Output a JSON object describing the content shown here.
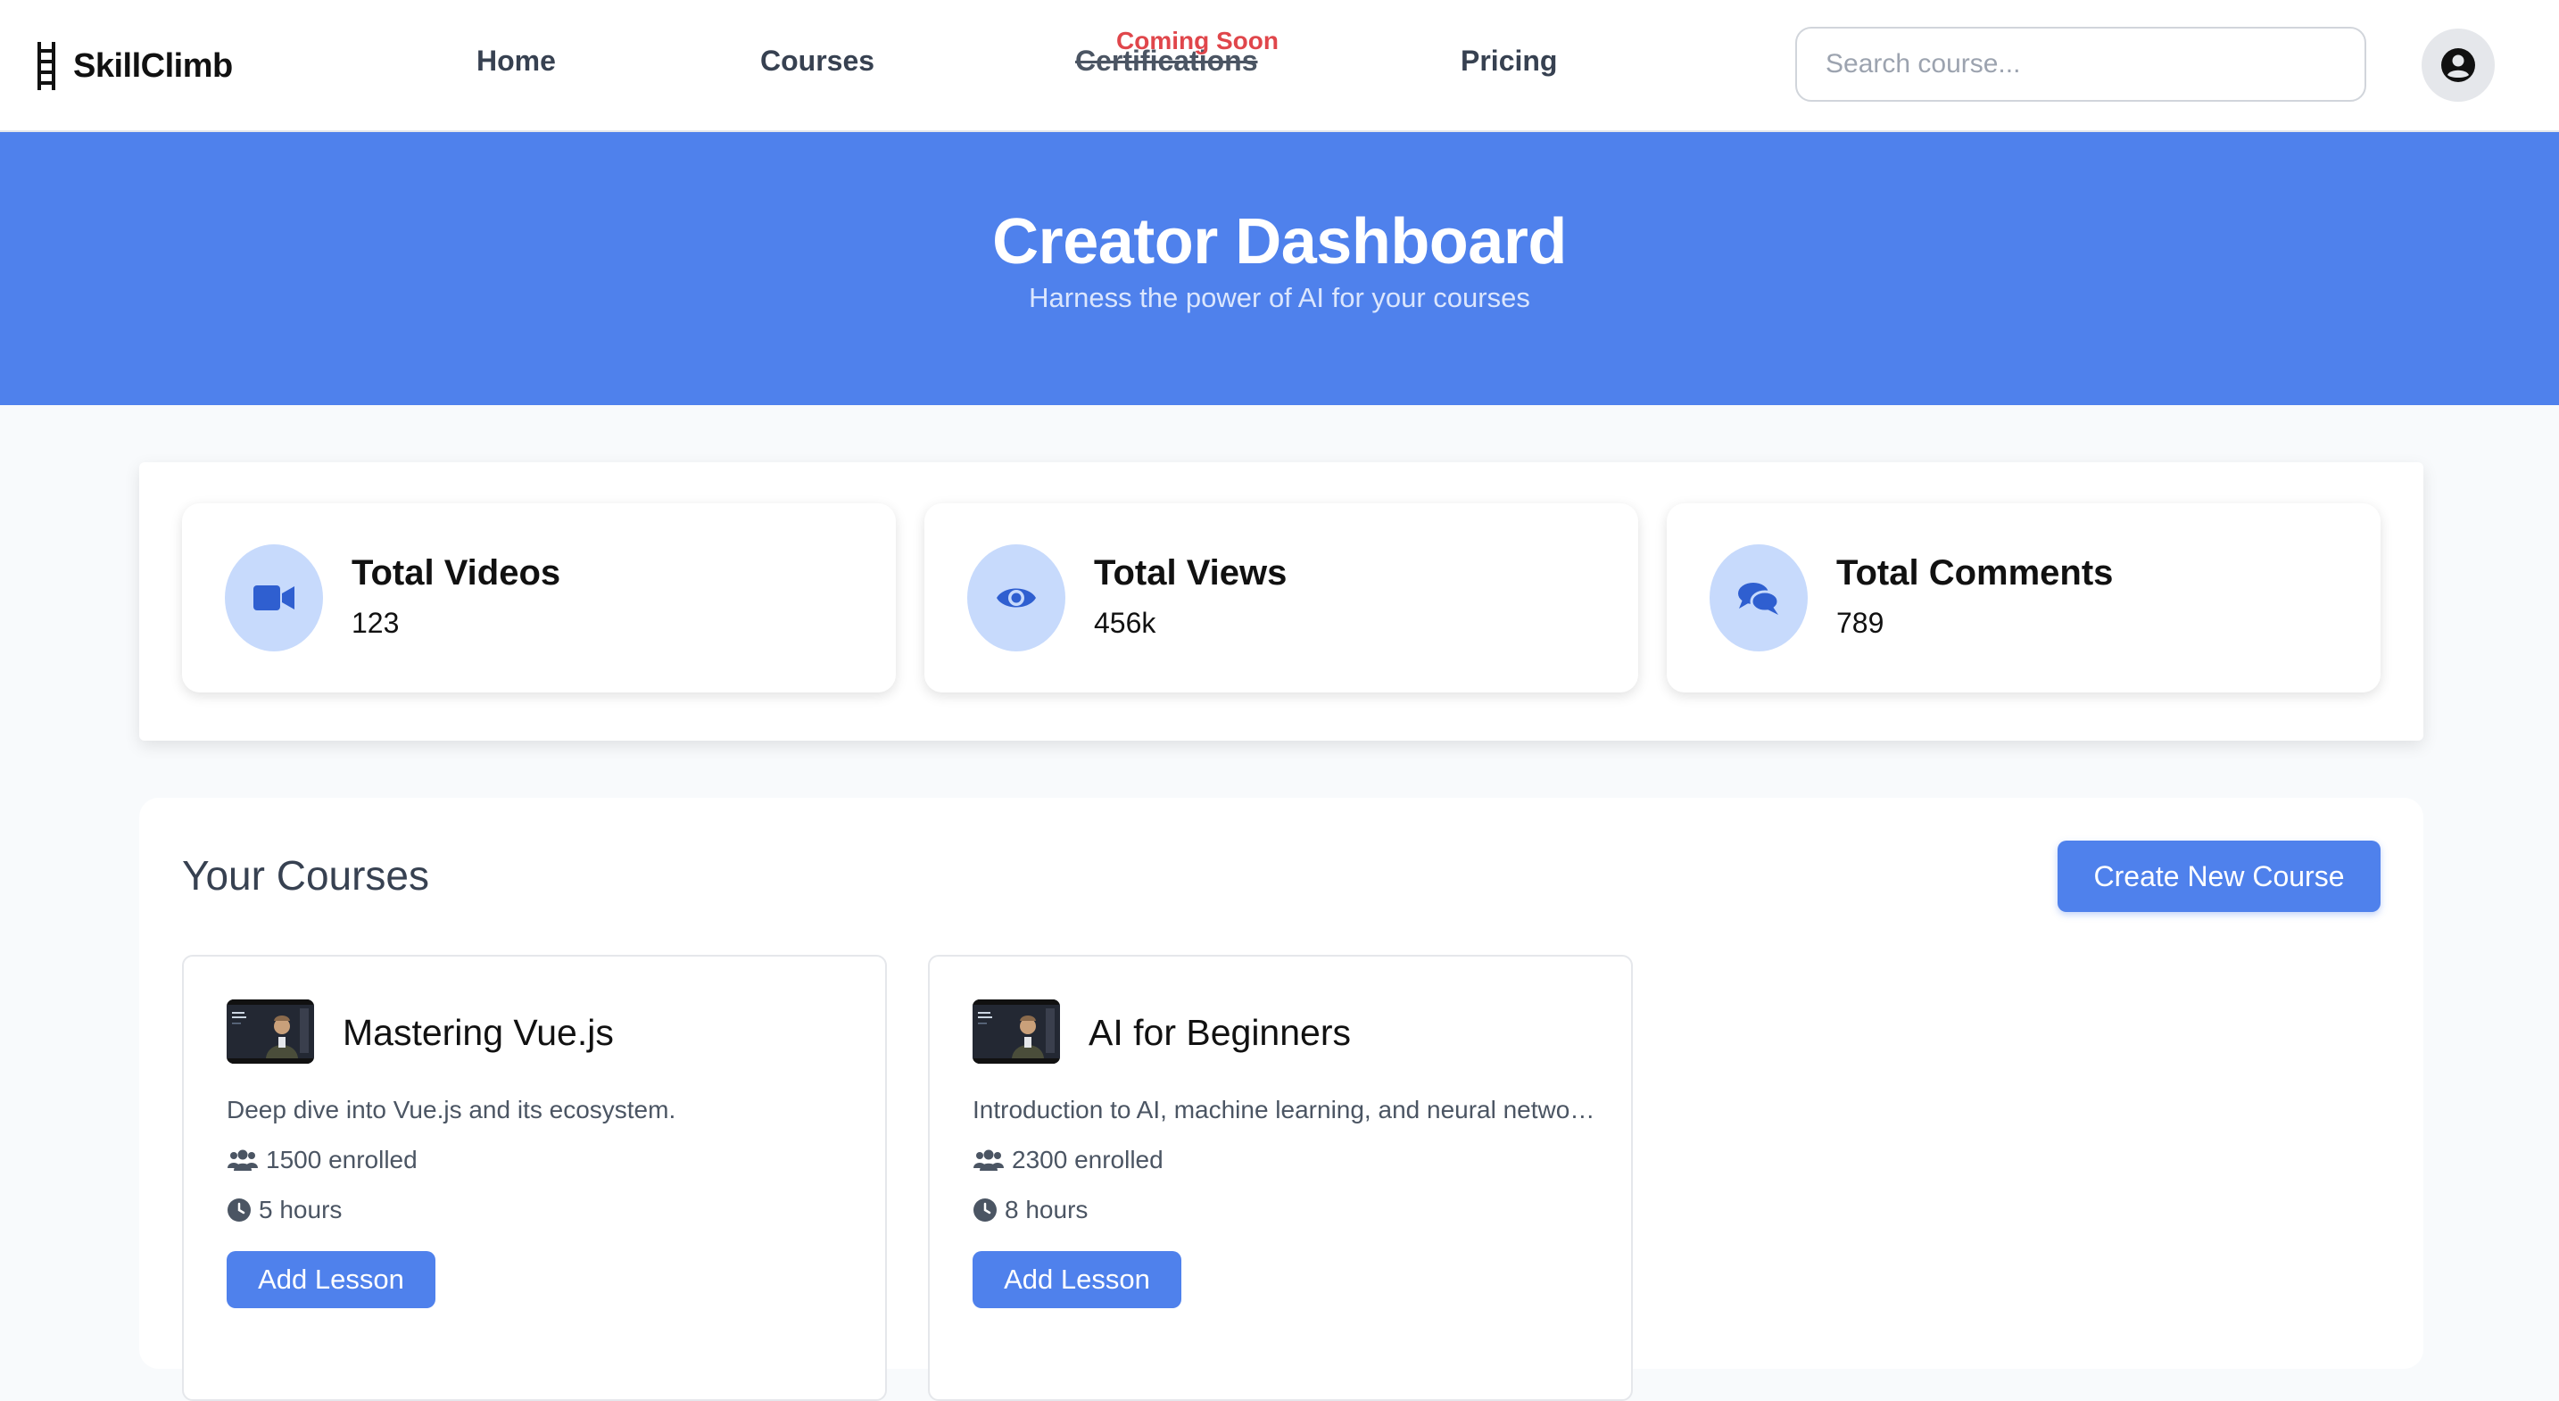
{
  "app": {
    "name": "SkillClimb",
    "logo_icon": "ladder-icon"
  },
  "nav": {
    "home": "Home",
    "courses": "Courses",
    "certifications": "Certifications",
    "coming_soon": "Coming Soon",
    "pricing": "Pricing"
  },
  "search": {
    "placeholder": "Search course..."
  },
  "user": {
    "icon": "user-circle-icon"
  },
  "hero": {
    "title": "Creator Dashboard",
    "subtitle": "Harness the power of AI for your courses"
  },
  "stats": [
    {
      "label": "Total Videos",
      "value": "123",
      "icon": "video-camera-icon"
    },
    {
      "label": "Total Views",
      "value": "456k",
      "icon": "eye-icon"
    },
    {
      "label": "Total Comments",
      "value": "789",
      "icon": "comments-icon"
    }
  ],
  "courses_section": {
    "title": "Your Courses",
    "create_label": "Create New Course"
  },
  "courses": [
    {
      "title": "Mastering Vue.js",
      "description": "Deep dive into Vue.js and its ecosystem.",
      "enrolled": "1500 enrolled",
      "duration": "5 hours",
      "action": "Add Lesson"
    },
    {
      "title": "AI for Beginners",
      "description": "Introduction to AI, machine learning, and neural networks.",
      "enrolled": "2300 enrolled",
      "duration": "8 hours",
      "action": "Add Lesson"
    }
  ],
  "colors": {
    "primary": "#4f81ec",
    "icon_bg": "#c7dafc",
    "icon_fg": "#2f5fd0",
    "coming_soon": "#e0464b"
  }
}
